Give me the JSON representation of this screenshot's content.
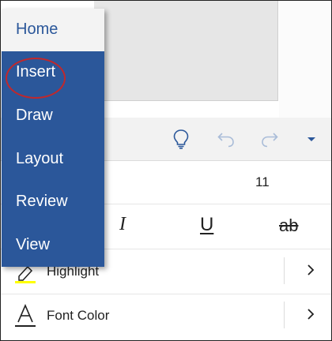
{
  "menu": {
    "items": [
      {
        "label": "Home",
        "active": true
      },
      {
        "label": "Insert",
        "active": false,
        "annotated": true
      },
      {
        "label": "Draw",
        "active": false
      },
      {
        "label": "Layout",
        "active": false
      },
      {
        "label": "Review",
        "active": false
      },
      {
        "label": "View",
        "active": false
      }
    ]
  },
  "toolbar": {
    "icons": [
      "lightbulb-icon",
      "undo-icon",
      "redo-icon",
      "caret-down-icon"
    ]
  },
  "font": {
    "size": "11"
  },
  "format": {
    "italic": "I",
    "underline": "U",
    "strikethrough": "ab"
  },
  "list": {
    "highlight_label": "Highlight",
    "font_color_label": "Font Color"
  },
  "colors": {
    "menu_bg": "#2b579a",
    "annotation_oval": "#c0282c",
    "highlight_swatch": "#ffff00",
    "toolbar_icon_active": "#2b579a",
    "toolbar_icon_disabled": "#a9bcd8"
  }
}
